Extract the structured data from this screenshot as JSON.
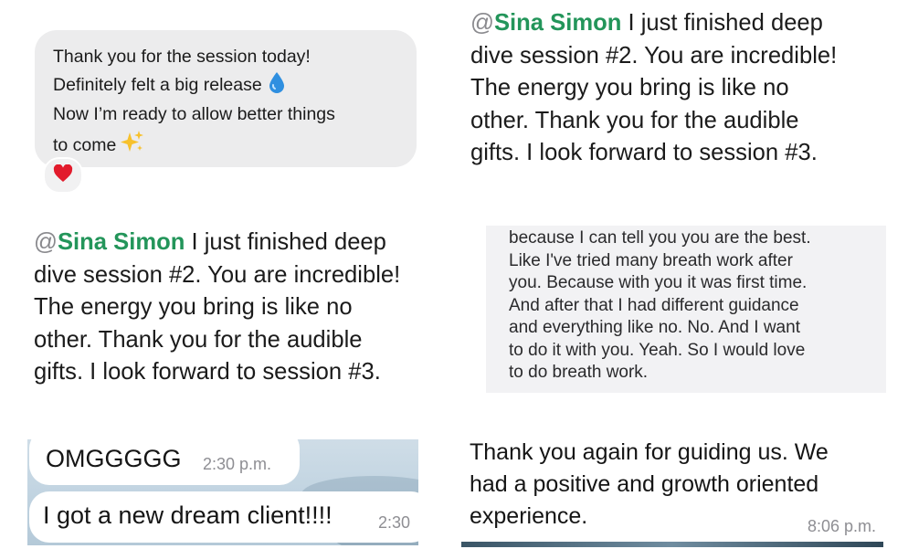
{
  "panel1": {
    "lines": [
      "Thank you for the session today!",
      "Definitely felt a big release",
      "Now I’m ready to allow better things",
      "to come"
    ],
    "reaction_icon": "red-heart-icon"
  },
  "panel2": {
    "at": "@",
    "mention": "Sina Simon",
    "first_line_rest": " I just finished deep",
    "lines": [
      "dive session #2. You are incredible!",
      "The energy you bring is like no",
      "other. Thank you for the audible",
      "gifts. I look forward to session #3."
    ]
  },
  "panel3": {
    "at": "@",
    "mention": "Sina Simon",
    "first_line_rest": " I just finished deep",
    "lines": [
      "dive session #2. You are incredible!",
      "The energy you bring is like no",
      "other. Thank you for the audible",
      "gifts. I look forward to session #3."
    ]
  },
  "panel4": {
    "lines": [
      "because I can tell you you are the best.",
      "Like I've tried many breath work after",
      "you. Because with you it was first time.",
      "And after that I had different guidance",
      "and everything like no. No. And I want",
      "to do it with you. Yeah. So I would love",
      "to do breath work."
    ]
  },
  "panel5": {
    "msg1": {
      "text": "OMGGGGG",
      "time": "2:30 p.m."
    },
    "msg2": {
      "text": "I got a new dream client!!!!",
      "time": "2:30"
    }
  },
  "panel6": {
    "lines": [
      "Thank you again for guiding us. We",
      "had a positive and growth oriented",
      "experience."
    ],
    "time": "8:06 p.m."
  }
}
